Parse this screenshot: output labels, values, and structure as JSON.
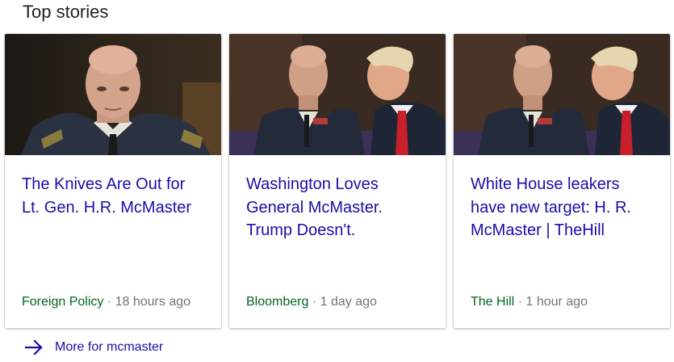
{
  "section": {
    "title": "Top stories"
  },
  "cards": [
    {
      "headline": "The Knives Are Out for Lt. Gen. H.R. McMaster",
      "source": "Foreign Policy",
      "separator": "·",
      "age": "18 hours ago"
    },
    {
      "headline": "Washington Loves General McMaster. Trump Doesn't.",
      "source": "Bloomberg",
      "separator": "·",
      "age": "1 day ago"
    },
    {
      "headline": "White House leakers have new target: H. R. McMaster | TheHill",
      "source": "The Hill",
      "separator": "·",
      "age": "1 hour ago"
    }
  ],
  "more": {
    "label": "More for mcmaster",
    "icon": "arrow-right-icon"
  },
  "colors": {
    "link": "#1a0dab",
    "source": "#006621",
    "meta": "#70757a"
  }
}
